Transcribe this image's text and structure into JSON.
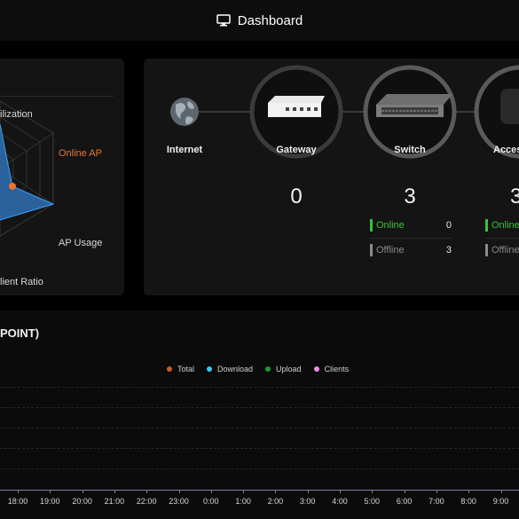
{
  "header": {
    "title": "Dashboard",
    "icon": "monitor-icon"
  },
  "radar": {
    "labels": {
      "utilization": "ilization",
      "online_ap": "Online AP",
      "ap_usage": "AP Usage",
      "client_ratio": "lient Ratio"
    },
    "colors": {
      "fill": "#2f86d6",
      "stroke": "#3aa0ff",
      "accent": "#e8792e"
    }
  },
  "topology": {
    "internet": {
      "label": "Internet",
      "icon": "globe-icon"
    },
    "gateway": {
      "label": "Gateway",
      "count": "0",
      "icon": "gateway-device-icon"
    },
    "switch": {
      "label": "Switch",
      "count": "3",
      "icon": "switch-device-icon",
      "online_label": "Online",
      "online_count": "0",
      "offline_label": "Offline",
      "offline_count": "3"
    },
    "access_point": {
      "label": "Acces",
      "count": "3",
      "icon": "access-point-device-icon",
      "online_label": "Online",
      "offline_label": "Offline"
    }
  },
  "traffic": {
    "title": "POINT)",
    "legend": [
      {
        "label": "Total",
        "color": "#c0611c"
      },
      {
        "label": "Download",
        "color": "#39c9f0"
      },
      {
        "label": "Upload",
        "color": "#1f9a2c"
      },
      {
        "label": "Clients",
        "color": "#f08cf0"
      }
    ],
    "x_labels": [
      "18:00",
      "19:00",
      "20:00",
      "21:00",
      "22:00",
      "23:00",
      "0:00",
      "1:00",
      "2:00",
      "3:00",
      "4:00",
      "5:00",
      "6:00",
      "7:00",
      "8:00",
      "9:00"
    ]
  }
}
